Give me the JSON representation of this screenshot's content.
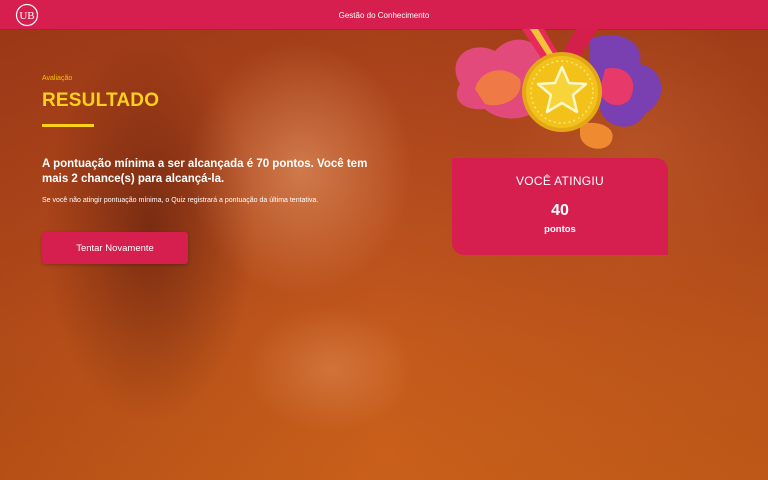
{
  "header": {
    "logo_text": "UB",
    "title": "Gestão do Conhecimento"
  },
  "main": {
    "breadcrumb": "Avaliação",
    "title": "RESULTADO",
    "message": "A pontuação mínima a ser alcançada é 70 pontos. Você tem mais 2 chance(s) para alcançá-la.",
    "note": "Se você não atingir pontuação mínima, o Quiz registrará a pontuação da última tentativa.",
    "retry_label": "Tentar Novamente"
  },
  "result": {
    "label": "VOCÊ ATINGIU",
    "score": "40",
    "unit": "pontos"
  },
  "colors": {
    "brand": "#d61f4f",
    "accent": "#ffd21a",
    "medal_gold": "#f2c21b"
  }
}
